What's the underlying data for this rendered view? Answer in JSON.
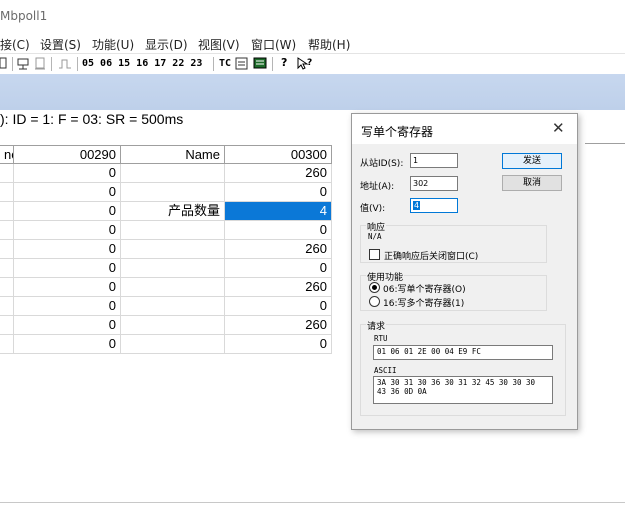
{
  "window": {
    "title": "Mbpoll1"
  },
  "menu": [
    "接(C)",
    "设置(S)",
    "功能(U)",
    "显示(D)",
    "视图(V)",
    "窗口(W)",
    "帮助(H)"
  ],
  "toolbar": {
    "function_codes": "05 06 15 16 17 22 23",
    "tc_label": "TC"
  },
  "status_line": "): ID = 1: F = 03: SR = 500ms",
  "grid": {
    "headers": [
      "ne",
      "00290",
      "Name",
      "00300"
    ],
    "rows": [
      {
        "v290": "0",
        "name": "",
        "v300": "260"
      },
      {
        "v290": "0",
        "name": "",
        "v300": "0"
      },
      {
        "v290": "0",
        "name": "产品数量",
        "v300": "4"
      },
      {
        "v290": "0",
        "name": "",
        "v300": "0"
      },
      {
        "v290": "0",
        "name": "",
        "v300": "260"
      },
      {
        "v290": "0",
        "name": "",
        "v300": "0"
      },
      {
        "v290": "0",
        "name": "",
        "v300": "260"
      },
      {
        "v290": "0",
        "name": "",
        "v300": "0"
      },
      {
        "v290": "0",
        "name": "",
        "v300": "260"
      },
      {
        "v290": "0",
        "name": "",
        "v300": "0"
      }
    ]
  },
  "dialog": {
    "title": "写单个寄存器",
    "close": "✕",
    "slave_id_label": "从站ID(S):",
    "slave_id_value": "1",
    "address_label": "地址(A):",
    "address_value": "302",
    "value_label": "值(V):",
    "value_value": "4",
    "send_button": "发送",
    "cancel_button": "取消",
    "response_group": "响应",
    "response_value": "N/A",
    "close_after_label": "正确响应后关闭窗口(C)",
    "function_group": "使用功能",
    "func_06_label": "06:写单个寄存器(O)",
    "func_16_label": "16:写多个寄存器(1)",
    "request_group": "请求",
    "rtu_label": "RTU",
    "rtu_value": "01 06 01 2E 00 04 E9 FC",
    "ascii_label": "ASCII",
    "ascii_line1": "3A 30 31 30 36 30 31 32 45 30 30 30",
    "ascii_line2": "43 36 0D 0A"
  }
}
